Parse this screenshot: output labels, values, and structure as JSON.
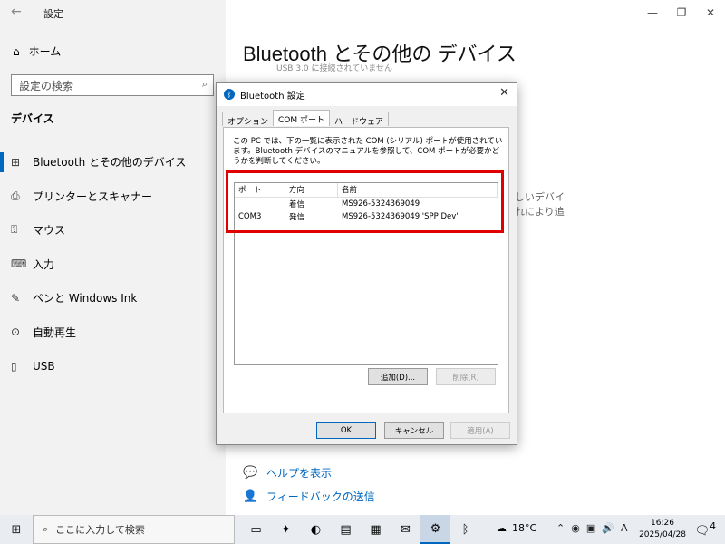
{
  "settings": {
    "app_title": "設定",
    "window_controls": {
      "minimize": "—",
      "maximize": "❐",
      "close": "✕"
    },
    "home_label": "ホーム",
    "search_placeholder": "設定の検索",
    "section_label": "デバイス",
    "nav_items": [
      {
        "label": "Bluetooth とその他のデバイス",
        "icon": "bluetooth-devices-icon",
        "glyph": "⊞"
      },
      {
        "label": "プリンターとスキャナー",
        "icon": "printer-icon",
        "glyph": "⎙"
      },
      {
        "label": "マウス",
        "icon": "mouse-icon",
        "glyph": "⍰"
      },
      {
        "label": "入力",
        "icon": "keyboard-icon",
        "glyph": "⌨"
      },
      {
        "label": "ペンと Windows Ink",
        "icon": "pen-icon",
        "glyph": "✎"
      },
      {
        "label": "自動再生",
        "icon": "autoplay-icon",
        "glyph": "⊙"
      },
      {
        "label": "USB",
        "icon": "usb-icon",
        "glyph": "▯"
      }
    ],
    "main_title": "Bluetooth とその他の デバイス",
    "ghost_text_top": "USB 3.0 に接続されていません",
    "ghost_text_right_1": "しいデバイ",
    "ghost_text_right_2": "れにより追",
    "help_link": "ヘルプを表示",
    "feedback_link": "フィードバックの送信"
  },
  "dialog": {
    "title": "Bluetooth 設定",
    "close_glyph": "✕",
    "tabs": [
      "オプション",
      "COM ポート",
      "ハードウェア"
    ],
    "active_tab": 1,
    "description": "この PC では、下の一覧に表示された COM (シリアル) ポートが使用されています。Bluetooth デバイスのマニュアルを参照して、COM ポートが必要かどうかを判断してください。",
    "columns": [
      "ポート",
      "方向",
      "名前"
    ],
    "rows": [
      {
        "port": "",
        "direction": "着信",
        "name": "MS926-5324369049"
      },
      {
        "port": "COM3",
        "direction": "発信",
        "name": "MS926-5324369049 'SPP Dev'"
      }
    ],
    "add_button": "追加(D)...",
    "remove_button": "削除(R)",
    "ok_button": "OK",
    "cancel_button": "キャンセル",
    "apply_button": "適用(A)"
  },
  "taskbar": {
    "search_placeholder": "ここに入力して検索",
    "weather": "18°C",
    "ime": "A",
    "time": "16:26",
    "date": "2025/04/28",
    "notification_count": "4"
  }
}
